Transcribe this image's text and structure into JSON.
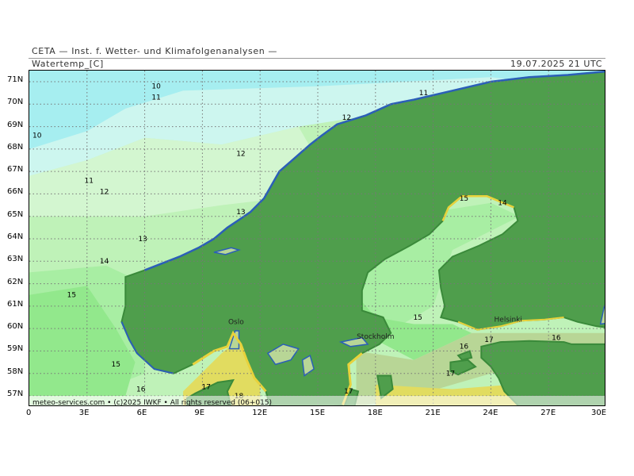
{
  "header": {
    "institute": "CETA — Inst. f. Wetter- und Klimafolgenanalysen —",
    "parameter": "Watertemp_[C]",
    "valid_time": "19.07.2025 21 UTC"
  },
  "axes": {
    "lat_labels": [
      "71N",
      "70N",
      "69N",
      "68N",
      "67N",
      "66N",
      "65N",
      "64N",
      "63N",
      "62N",
      "61N",
      "60N",
      "59N",
      "58N",
      "57N"
    ],
    "lon_labels": [
      "0",
      "3E",
      "6E",
      "9E",
      "12E",
      "15E",
      "18E",
      "21E",
      "24E",
      "27E",
      "30E"
    ]
  },
  "isotherm_labels": [
    {
      "text": "10",
      "lon": 6.6,
      "lat": 70.7
    },
    {
      "text": "11",
      "lon": 6.6,
      "lat": 70.2
    },
    {
      "text": "10",
      "lon": 0.4,
      "lat": 68.5
    },
    {
      "text": "12",
      "lon": 11.0,
      "lat": 67.7
    },
    {
      "text": "11",
      "lon": 3.1,
      "lat": 66.5
    },
    {
      "text": "12",
      "lon": 3.9,
      "lat": 66.0
    },
    {
      "text": "13",
      "lon": 11.0,
      "lat": 65.1
    },
    {
      "text": "13",
      "lon": 5.9,
      "lat": 63.9
    },
    {
      "text": "14",
      "lon": 3.9,
      "lat": 62.9
    },
    {
      "text": "15",
      "lon": 2.2,
      "lat": 61.4
    },
    {
      "text": "15",
      "lon": 4.5,
      "lat": 58.3
    },
    {
      "text": "16",
      "lon": 5.8,
      "lat": 57.2
    },
    {
      "text": "17",
      "lon": 9.2,
      "lat": 57.3
    },
    {
      "text": "18",
      "lon": 10.9,
      "lat": 56.9
    },
    {
      "text": "12",
      "lon": 16.5,
      "lat": 69.3
    },
    {
      "text": "11",
      "lon": 20.5,
      "lat": 70.4
    },
    {
      "text": "15",
      "lon": 22.6,
      "lat": 65.7
    },
    {
      "text": "14",
      "lon": 24.6,
      "lat": 65.5
    },
    {
      "text": "15",
      "lon": 20.2,
      "lat": 60.4
    },
    {
      "text": "16",
      "lon": 22.6,
      "lat": 59.1
    },
    {
      "text": "17",
      "lon": 23.9,
      "lat": 59.4
    },
    {
      "text": "16",
      "lon": 27.4,
      "lat": 59.5
    },
    {
      "text": "17",
      "lon": 21.9,
      "lat": 57.9
    },
    {
      "text": "17",
      "lon": 16.6,
      "lat": 57.1
    }
  ],
  "cities": [
    {
      "name": "Oslo",
      "lon": 10.75,
      "lat": 60.2
    },
    {
      "name": "Stockholm",
      "lon": 18.0,
      "lat": 59.55
    },
    {
      "name": "Helsinki",
      "lon": 24.9,
      "lat": 60.3
    }
  ],
  "credit": "meteo-services.com • (c)2025 IWKF • All rights reserved (06+015)",
  "colors": {
    "land": "#4f9e4c",
    "land_coast": "#3a8a3a",
    "coast_blue": "#2b5fb8",
    "coast_yellow": "#e8d23c",
    "sea_10": "#a6eef0",
    "sea_11": "#cdf6ef",
    "sea_12": "#d3f6d0",
    "sea_13": "#bff2b8",
    "sea_14": "#a8eea3",
    "sea_15": "#92e88c",
    "sea_16": "#b8d696",
    "sea_17": "#e1dc60",
    "sea_18": "#efe072",
    "grid": "#777777"
  }
}
